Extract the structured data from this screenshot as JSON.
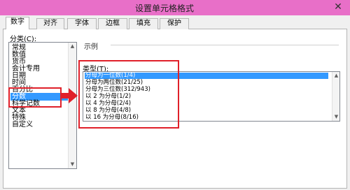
{
  "window": {
    "title": "设置单元格格式",
    "close_glyph": "✕"
  },
  "tabs": [
    {
      "label": "数字",
      "active": true
    },
    {
      "label": "对齐"
    },
    {
      "label": "字体"
    },
    {
      "label": "边框"
    },
    {
      "label": "填充"
    },
    {
      "label": "保护"
    }
  ],
  "category": {
    "label": "分类(C):",
    "selected": "分数",
    "items": [
      "常规",
      "数值",
      "货币",
      "会计专用",
      "日期",
      "时间",
      "百分比",
      "分数",
      "科学记数",
      "文本",
      "特殊",
      "自定义"
    ]
  },
  "example": {
    "label": "示例"
  },
  "type": {
    "label": "类型(T):",
    "selected": "分母为一位数(1/4)",
    "items": [
      "分母为一位数(1/4)",
      "分母为两位数(21/25)",
      "分母为三位数(312/943)",
      "以 2 为分母(1/2)",
      "以 4 为分母(2/4)",
      "以 8 为分母(4/8)",
      "以 16 为分母(8/16)"
    ]
  },
  "colors": {
    "titlebar": "#e86fc8",
    "selection": "#3399ff",
    "annotation": "#e0202a"
  }
}
